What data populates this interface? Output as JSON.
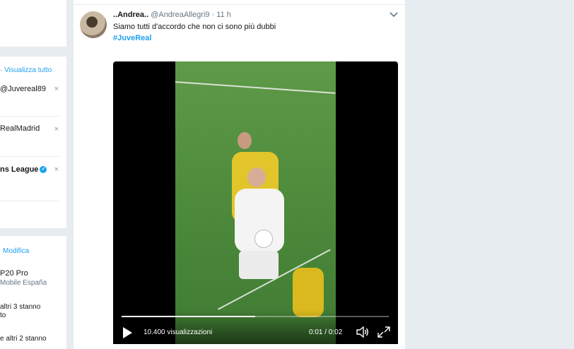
{
  "sidebar": {
    "follow_card": {
      "dot": "·",
      "view_all_label": "Visualizza tutto",
      "accounts": [
        {
          "label": "@Juvereal89",
          "bold": false
        },
        {
          "label": "RealMadrid",
          "bold": false
        },
        {
          "label": "ns League",
          "bold": true,
          "verified": true
        }
      ],
      "dismiss_glyph": "×"
    },
    "trends_card": {
      "edit_label": "Modifica",
      "item1_title": "P20 Pro",
      "item1_sub": "Mobile España",
      "item2_line1": "altri 3 stanno",
      "item2_line2": "to",
      "item3_line1": "e altri 2 stanno"
    }
  },
  "tweet": {
    "display_name": "..Andrea..",
    "handle": "@AndreaAllegri9",
    "time": "· 11 h",
    "text": "Siamo tutti d'accordo che non ci sono più dubbi",
    "hashtag": "#JuveReal",
    "menu_icon": "chevron-down-icon"
  },
  "video": {
    "views": "10.400 visualizzazioni",
    "time": "0:01 / 0:02",
    "progress": 0.5,
    "play_icon": "play-icon",
    "volume_icon": "volume-icon",
    "fullscreen_icon": "fullscreen-icon"
  },
  "colors": {
    "accent": "#1da1f2",
    "background": "#e6ecf0",
    "muted": "#657786"
  }
}
